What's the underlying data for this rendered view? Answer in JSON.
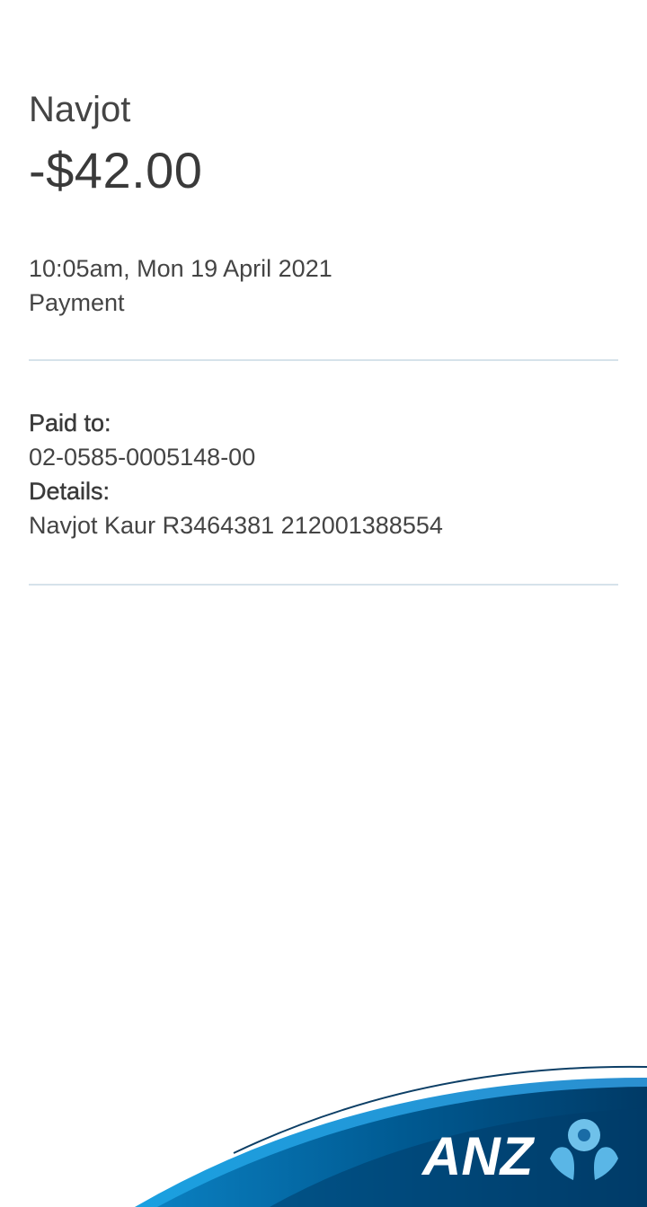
{
  "transaction": {
    "payee": "Navjot",
    "amount": "-$42.00",
    "datetime": "10:05am, Mon 19 April 2021",
    "type": "Payment"
  },
  "details": {
    "paid_to_label": "Paid to:",
    "paid_to_value": "02-0585-0005148-00",
    "details_label": "Details:",
    "details_value": "Navjot Kaur R3464381 212001388554"
  },
  "brand": {
    "logo_text": "ANZ",
    "colors": {
      "dark_blue": "#004165",
      "mid_blue": "#0072ac",
      "light_blue": "#3fa9e0",
      "divider": "#d6e2ea"
    }
  }
}
